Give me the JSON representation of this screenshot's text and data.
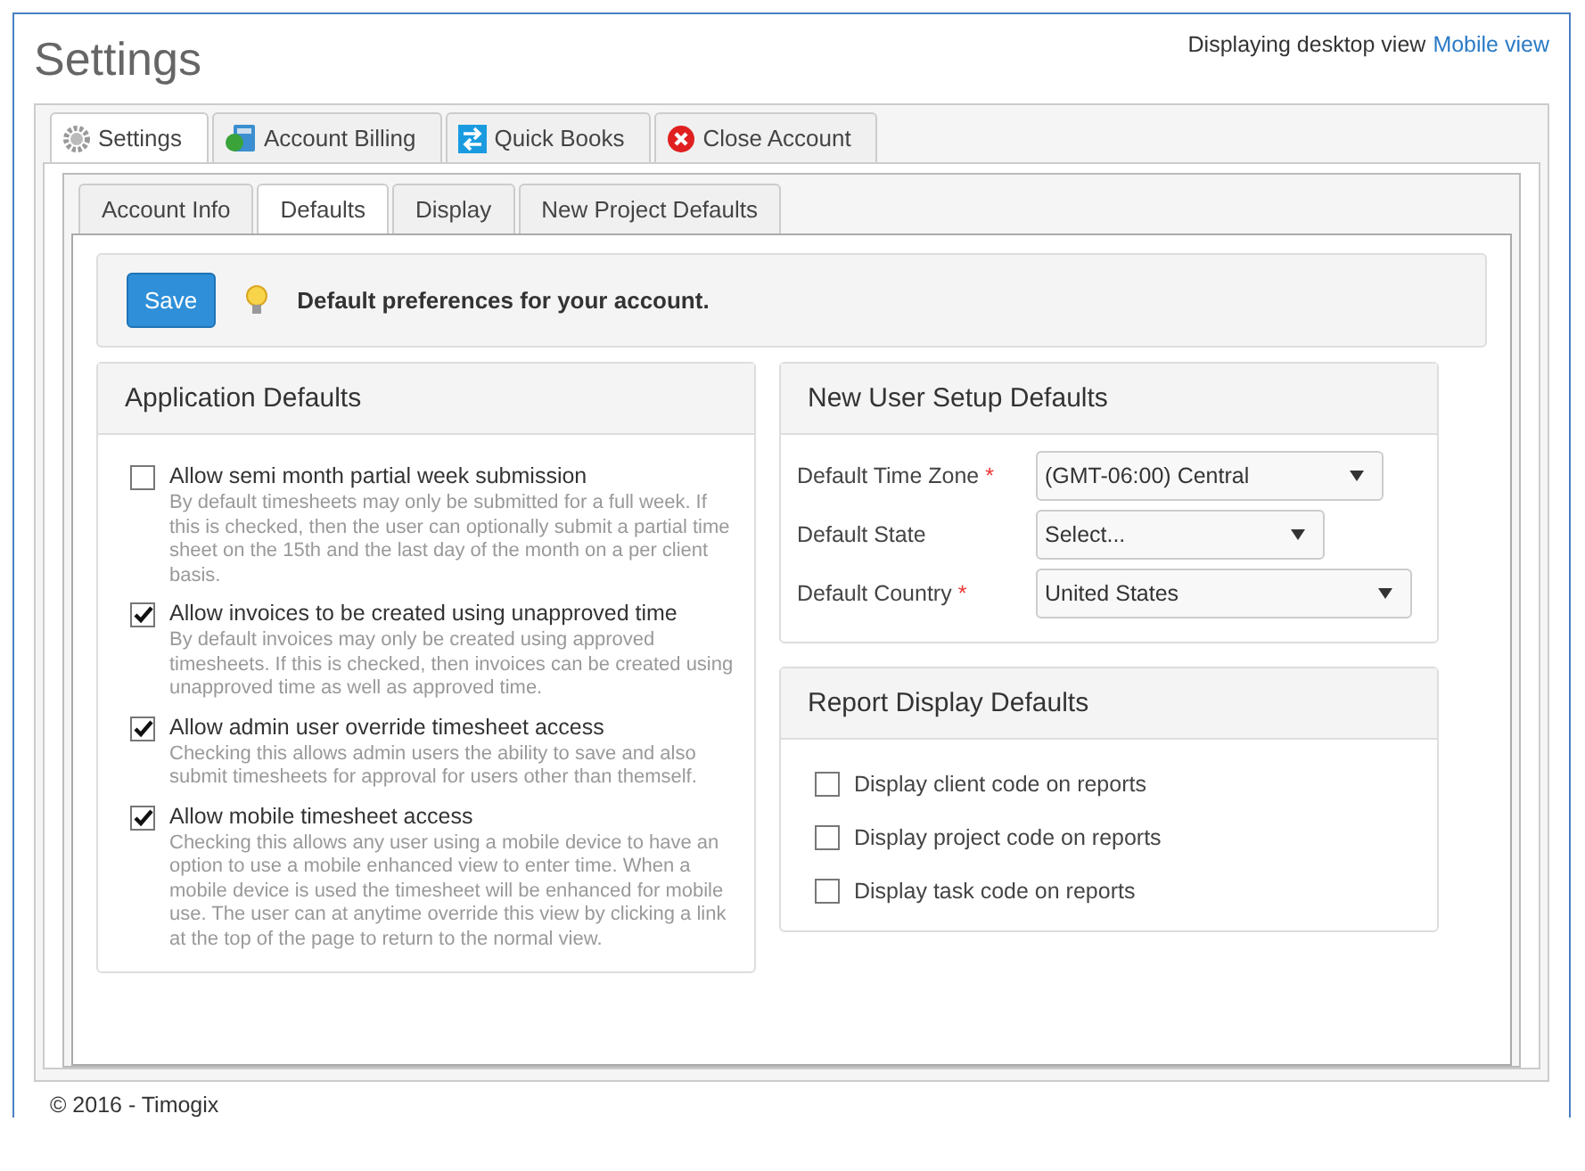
{
  "page_title": "Settings",
  "view_switch": {
    "current": "Displaying desktop view",
    "link": "Mobile view"
  },
  "main_tabs": [
    {
      "label": "Settings",
      "selected": true
    },
    {
      "label": "Account Billing",
      "selected": false
    },
    {
      "label": "Quick Books",
      "selected": false
    },
    {
      "label": "Close Account",
      "selected": false
    }
  ],
  "sub_tabs": [
    {
      "label": "Account Info",
      "selected": false
    },
    {
      "label": "Defaults",
      "selected": true
    },
    {
      "label": "Display",
      "selected": false
    },
    {
      "label": "New Project Defaults",
      "selected": false
    }
  ],
  "toolbar": {
    "button": "Save",
    "message": "Default preferences for your account."
  },
  "application_defaults": {
    "title": "Application Defaults",
    "options": [
      {
        "label": "Allow semi month partial week submission",
        "checked": false,
        "description": "By default timesheets may only be submitted for a full week. If this is checked, then the user can optionally submit a partial time sheet on the 15th and the last day of the month on a per client basis."
      },
      {
        "label": "Allow invoices to be created using unapproved time",
        "checked": true,
        "description": "By default invoices may only be created using approved timesheets. If this is checked, then invoices can be created using unapproved time as well as approved time."
      },
      {
        "label": "Allow admin user override timesheet access",
        "checked": true,
        "description": "Checking this allows admin users the ability to save and also submit timesheets for approval for users other than themself."
      },
      {
        "label": "Allow mobile timesheet access",
        "checked": true,
        "description": "Checking this allows any user using a mobile device to have an option to use a mobile enhanced view to enter time. When a mobile device is used the timesheet will be enhanced for mobile use. The user can at anytime override this view by clicking a link at the top of the page to return to the normal view."
      }
    ]
  },
  "new_user_setup": {
    "title": "New User Setup Defaults",
    "fields": [
      {
        "label": "Default Time Zone",
        "required_mark": "*",
        "value": "(GMT-06:00) Central"
      },
      {
        "label": "Default State",
        "value": "Select..."
      },
      {
        "label": "Default Country",
        "required_mark": "*",
        "value": "United States"
      }
    ]
  },
  "report_display": {
    "title": "Report Display Defaults",
    "options": [
      {
        "label": "Display client code on reports",
        "checked": false
      },
      {
        "label": "Display project code on reports",
        "checked": false
      },
      {
        "label": "Display task code on reports",
        "checked": false
      }
    ]
  },
  "footer": "© 2016 - Timogix"
}
